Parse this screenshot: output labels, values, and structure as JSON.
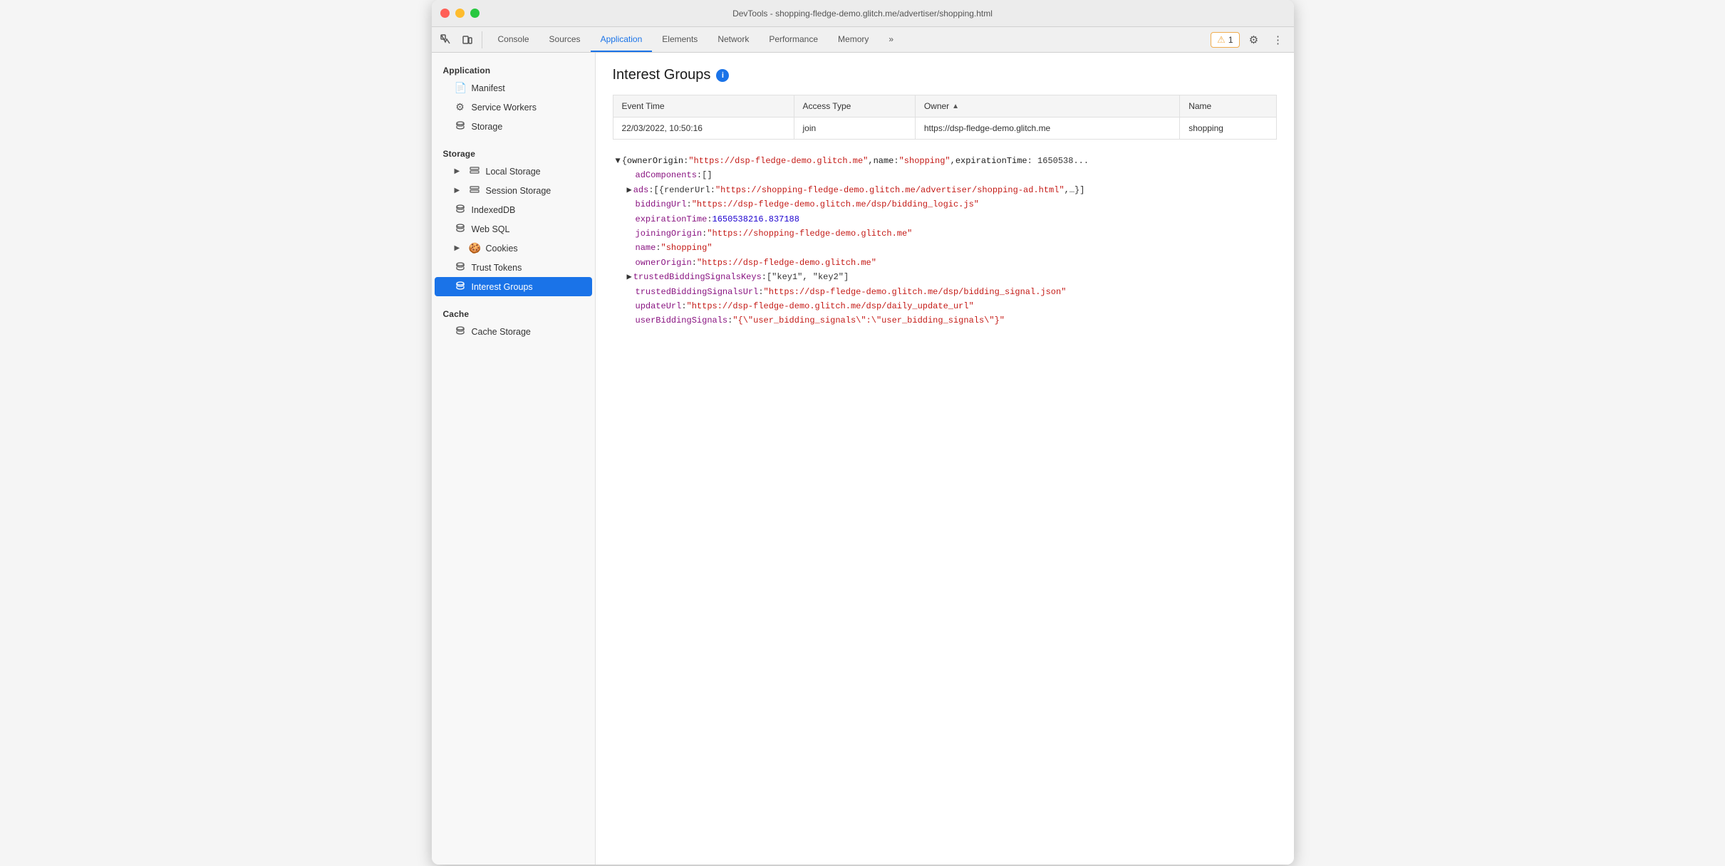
{
  "titlebar": {
    "title": "DevTools - shopping-fledge-demo.glitch.me/advertiser/shopping.html"
  },
  "toolbar": {
    "tabs": [
      {
        "id": "console",
        "label": "Console",
        "active": false
      },
      {
        "id": "sources",
        "label": "Sources",
        "active": false
      },
      {
        "id": "application",
        "label": "Application",
        "active": true
      },
      {
        "id": "elements",
        "label": "Elements",
        "active": false
      },
      {
        "id": "network",
        "label": "Network",
        "active": false
      },
      {
        "id": "performance",
        "label": "Performance",
        "active": false
      },
      {
        "id": "memory",
        "label": "Memory",
        "active": false
      }
    ],
    "more_label": "»",
    "warning_count": "1",
    "warning_icon": "⚠"
  },
  "sidebar": {
    "sections": [
      {
        "title": "Application",
        "items": [
          {
            "id": "manifest",
            "label": "Manifest",
            "icon": "📄",
            "active": false,
            "expandable": false
          },
          {
            "id": "service-workers",
            "label": "Service Workers",
            "icon": "⚙",
            "active": false,
            "expandable": false
          },
          {
            "id": "storage",
            "label": "Storage",
            "icon": "🗄",
            "active": false,
            "expandable": false
          }
        ]
      },
      {
        "title": "Storage",
        "items": [
          {
            "id": "local-storage",
            "label": "Local Storage",
            "icon": "⊞",
            "active": false,
            "expandable": true
          },
          {
            "id": "session-storage",
            "label": "Session Storage",
            "icon": "⊞",
            "active": false,
            "expandable": true
          },
          {
            "id": "indexeddb",
            "label": "IndexedDB",
            "icon": "🗄",
            "active": false,
            "expandable": false
          },
          {
            "id": "web-sql",
            "label": "Web SQL",
            "icon": "🗄",
            "active": false,
            "expandable": false
          },
          {
            "id": "cookies",
            "label": "Cookies",
            "icon": "🍪",
            "active": false,
            "expandable": true
          },
          {
            "id": "trust-tokens",
            "label": "Trust Tokens",
            "icon": "🗄",
            "active": false,
            "expandable": false
          },
          {
            "id": "interest-groups",
            "label": "Interest Groups",
            "icon": "🗄",
            "active": true,
            "expandable": false
          }
        ]
      },
      {
        "title": "Cache",
        "items": [
          {
            "id": "cache-storage",
            "label": "Cache Storage",
            "icon": "🗄",
            "active": false,
            "expandable": false
          }
        ]
      }
    ]
  },
  "content": {
    "heading": "Interest Groups",
    "info_tooltip": "i",
    "table": {
      "columns": [
        {
          "key": "event_time",
          "label": "Event Time"
        },
        {
          "key": "access_type",
          "label": "Access Type"
        },
        {
          "key": "owner",
          "label": "Owner",
          "sorted": true,
          "sort_dir": "asc"
        },
        {
          "key": "name",
          "label": "Name"
        }
      ],
      "rows": [
        {
          "event_time": "22/03/2022, 10:50:16",
          "access_type": "join",
          "owner": "https://dsp-fledge-demo.glitch.me",
          "name": "shopping"
        }
      ]
    },
    "json_detail": {
      "root_line": "▼ {ownerOrigin: \"https://dsp-fledge-demo.glitch.me\", name: \"shopping\", expirationTime: 1650538...",
      "lines": [
        {
          "indent": 1,
          "key": "adComponents",
          "punct": ": ",
          "value": "[]",
          "type": "bracket"
        },
        {
          "indent": 1,
          "expandable": true,
          "key": "ads",
          "punct": ": ",
          "value": "[{renderUrl: \"https://shopping-fledge-demo.glitch.me/advertiser/shopping-ad.html\",...}]",
          "type": "bracket"
        },
        {
          "indent": 1,
          "key": "biddingUrl",
          "punct": ": ",
          "value": "\"https://dsp-fledge-demo.glitch.me/dsp/bidding_logic.js\"",
          "type": "string"
        },
        {
          "indent": 1,
          "key": "expirationTime",
          "punct": ": ",
          "value": "1650538216.837188",
          "type": "number"
        },
        {
          "indent": 1,
          "key": "joiningOrigin",
          "punct": ": ",
          "value": "\"https://shopping-fledge-demo.glitch.me\"",
          "type": "string"
        },
        {
          "indent": 1,
          "key": "name",
          "punct": ": ",
          "value": "\"shopping\"",
          "type": "string"
        },
        {
          "indent": 1,
          "key": "ownerOrigin",
          "punct": ": ",
          "value": "\"https://dsp-fledge-demo.glitch.me\"",
          "type": "string"
        },
        {
          "indent": 1,
          "expandable": true,
          "key": "trustedBiddingSignalsKeys",
          "punct": ": ",
          "value": "[\"key1\", \"key2\"]",
          "type": "bracket"
        },
        {
          "indent": 1,
          "key": "trustedBiddingSignalsUrl",
          "punct": ": ",
          "value": "\"https://dsp-fledge-demo.glitch.me/dsp/bidding_signal.json\"",
          "type": "string"
        },
        {
          "indent": 1,
          "key": "updateUrl",
          "punct": ": ",
          "value": "\"https://dsp-fledge-demo.glitch.me/dsp/daily_update_url\"",
          "type": "string"
        },
        {
          "indent": 1,
          "key": "userBiddingSignals",
          "punct": ": ",
          "value": "\"{\\\"user_bidding_signals\\\":\\\"user_bidding_signals\\\"}\"",
          "type": "string"
        }
      ]
    }
  }
}
